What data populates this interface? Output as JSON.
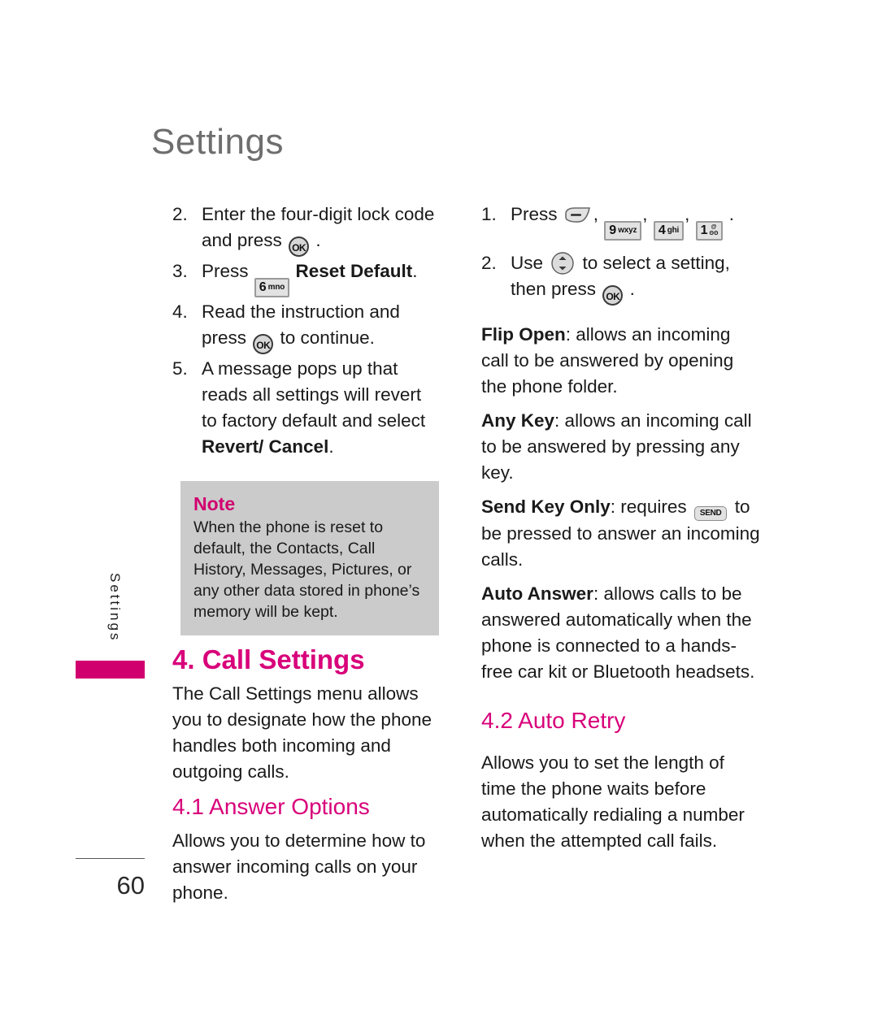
{
  "page": {
    "header_title": "Settings",
    "side_tab_label": "Settings",
    "page_number": "60"
  },
  "icons": {
    "ok_key": "OK",
    "send_key": "SEND",
    "key_6": {
      "digit": "6",
      "letters": "mno"
    },
    "key_9": {
      "digit": "9",
      "letters": "wxyz"
    },
    "key_4": {
      "digit": "4",
      "letters": "ghi"
    },
    "key_1": {
      "digit": "1",
      "top": "@",
      "bottom": "ʘʘ"
    }
  },
  "left_column": {
    "steps": [
      {
        "num": "2.",
        "text_before": "Enter the four-digit lock code and press ",
        "text_after": " ."
      },
      {
        "num": "3.",
        "text_before": "Press ",
        "bold_text": "Reset Default",
        "text_after": "."
      },
      {
        "num": "4.",
        "text_before": "Read the instruction and press ",
        "text_after": " to continue."
      },
      {
        "num": "5.",
        "text_before": "A message pops up that reads all settings will revert to factory default and select ",
        "bold_text": "Revert/ Cancel",
        "text_after": "."
      }
    ],
    "note": {
      "title": "Note",
      "body": "When the phone is reset to default, the Contacts, Call History, Messages, Pictures, or any other data stored in phone’s memory will be kept."
    },
    "section_call_settings": {
      "heading": "4. Call Settings",
      "body": "The Call Settings menu allows you to designate how the phone handles both incoming and outgoing calls."
    },
    "section_answer_options": {
      "heading": "4.1 Answer Options",
      "body": "Allows you to determine how to answer incoming calls on your phone."
    }
  },
  "right_column": {
    "steps": [
      {
        "num": "1.",
        "text_before": "Press ",
        "text_after": " ."
      },
      {
        "num": "2.",
        "text_before": "Use ",
        "text_mid": " to select a setting, then press ",
        "text_after": " ."
      }
    ],
    "definitions": [
      {
        "term": "Flip Open",
        "body": ": allows an incoming call to be answered by opening the phone folder."
      },
      {
        "term": "Any Key",
        "body": ": allows an incoming call to be answered by pressing any key."
      },
      {
        "term": "Send Key Only",
        "body_before": ": requires ",
        "body_after": " to be pressed to answer an incoming calls."
      },
      {
        "term": "Auto Answer",
        "body": ": allows calls to be answered automatically when the phone is connected to a hands-free car kit or Bluetooth headsets."
      }
    ],
    "section_auto_retry": {
      "heading": "4.2 Auto Retry",
      "body": "Allows you to set the length of time the phone waits before automatically redialing a number when the attempted call fails."
    }
  },
  "colors": {
    "magenta": "#d1006f",
    "heading_magenta": "#d8007a",
    "note_bg": "#cbcbcb",
    "header_gray": "#6e6e6e"
  }
}
